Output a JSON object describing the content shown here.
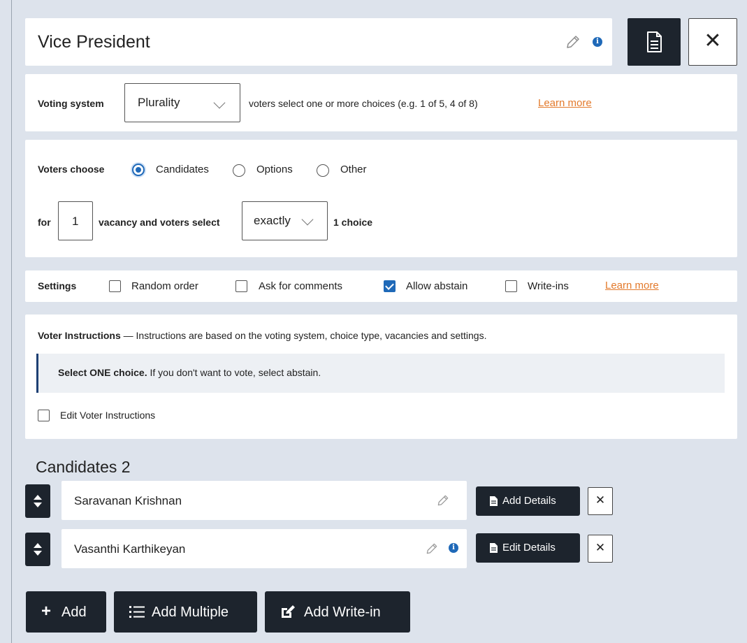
{
  "header": {
    "title": "Vice President",
    "close_label": "✕"
  },
  "voting_system": {
    "label": "Voting system",
    "selected": "Plurality",
    "description": "voters select one or more choices (e.g. 1 of 5, 4 of 8)",
    "learn_more": "Learn more"
  },
  "voters_choose": {
    "label": "Voters choose",
    "options": [
      "Candidates",
      "Options",
      "Other"
    ],
    "selected_option": "Candidates",
    "for_label": "for",
    "vacancies": "1",
    "vacancy_text": "vacancy and voters select",
    "select_mode": "exactly",
    "choice_text": "1 choice"
  },
  "settings": {
    "label": "Settings",
    "items": [
      {
        "label": "Random order",
        "checked": false
      },
      {
        "label": "Ask for comments",
        "checked": false
      },
      {
        "label": "Allow abstain",
        "checked": true
      },
      {
        "label": "Write-ins",
        "checked": false
      }
    ],
    "learn_more": "Learn more"
  },
  "instructions": {
    "title": "Voter Instructions",
    "description": " — Instructions are based on the voting system, choice type, vacancies and settings.",
    "box_bold": "Select ONE choice.",
    "box_text": " If you don't want to vote, select abstain.",
    "edit_label": "Edit Voter Instructions",
    "edit_checked": false
  },
  "candidates": {
    "title": "Candidates 2",
    "list": [
      {
        "name": "Saravanan Krishnan",
        "button": "Add Details",
        "has_info": false
      },
      {
        "name": "Vasanthi Karthikeyan",
        "button": "Edit Details",
        "has_info": true
      }
    ]
  },
  "actions": {
    "add": "Add",
    "add_multiple": "Add Multiple",
    "add_write_in": "Add Write-in"
  },
  "colors": {
    "accent": "#1f69b8",
    "dark": "#1d242d",
    "link": "#e37a2c",
    "background": "#dde3ec"
  }
}
